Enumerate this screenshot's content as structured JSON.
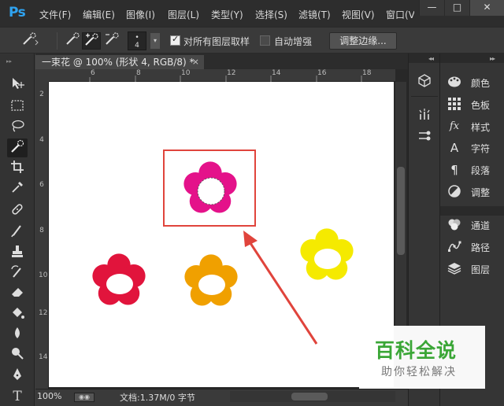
{
  "app": {
    "logo": "Ps",
    "menu": [
      "文件(F)",
      "编辑(E)",
      "图像(I)",
      "图层(L)",
      "类型(Y)",
      "选择(S)",
      "滤镜(T)",
      "视图(V)",
      "窗口(V"
    ],
    "window_controls": {
      "minimize": "—",
      "maximize": "□",
      "close": "✕"
    }
  },
  "options_bar": {
    "brush_size": "4",
    "sample_all_layers_label": "对所有图层取样",
    "sample_all_layers_checked": true,
    "auto_enhance_label": "自动增强",
    "auto_enhance_checked": false,
    "refine_edge_label": "调整边缘..."
  },
  "document": {
    "tab_title": "一束花 @ 100% (形状 4, RGB/8) *",
    "tab_close": "×",
    "ruler_h": [
      "6",
      "8",
      "10",
      "12",
      "14",
      "16",
      "18"
    ],
    "ruler_v": [
      "2",
      "4",
      "6",
      "8",
      "10",
      "12",
      "14"
    ]
  },
  "canvas": {
    "flowers": [
      {
        "name": "magenta",
        "color": "#e4128a",
        "selected": true
      },
      {
        "name": "red",
        "color": "#e1143c"
      },
      {
        "name": "orange",
        "color": "#f0a000"
      },
      {
        "name": "yellow",
        "color": "#f5ea00"
      }
    ],
    "annotation_color": "#e0443c"
  },
  "status_bar": {
    "zoom": "100%",
    "doc_info": "文档:1.37M/0 字节"
  },
  "panels": {
    "group1": [
      {
        "label": "颜色",
        "icon": "color-palette-icon"
      },
      {
        "label": "色板",
        "icon": "swatches-grid-icon"
      },
      {
        "label": "样式",
        "icon": "styles-fx-icon"
      },
      {
        "label": "字符",
        "icon": "character-icon"
      },
      {
        "label": "段落",
        "icon": "paragraph-icon"
      },
      {
        "label": "调整",
        "icon": "adjustments-icon"
      }
    ],
    "group2": [
      {
        "label": "通道",
        "icon": "channels-icon"
      },
      {
        "label": "路径",
        "icon": "paths-icon"
      },
      {
        "label": "图层",
        "icon": "layers-icon"
      }
    ]
  },
  "watermark": {
    "main": "百科全说",
    "sub": "助你轻松解决",
    "color": "#3aa636"
  }
}
